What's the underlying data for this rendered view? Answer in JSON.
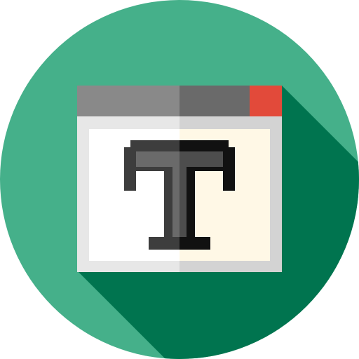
{
  "icon": {
    "name": "text-editor-window-icon",
    "glyph": "T",
    "colors": {
      "circle": "#45B08A",
      "shadow": "#00744F",
      "titlebar_left": "#898989",
      "titlebar_right": "#6A6A6A",
      "close_button": "#E24A3A",
      "frame_left": "#E7E7E7",
      "frame_right": "#D3D3D3",
      "content_left": "#FFFFFF",
      "content_right": "#FFF8E6",
      "glyph_left_fill": "#6A6A6A",
      "glyph_right_fill": "#4D4D4D",
      "glyph_left_outline": "#3D3D3D",
      "glyph_right_outline": "#111111"
    }
  }
}
